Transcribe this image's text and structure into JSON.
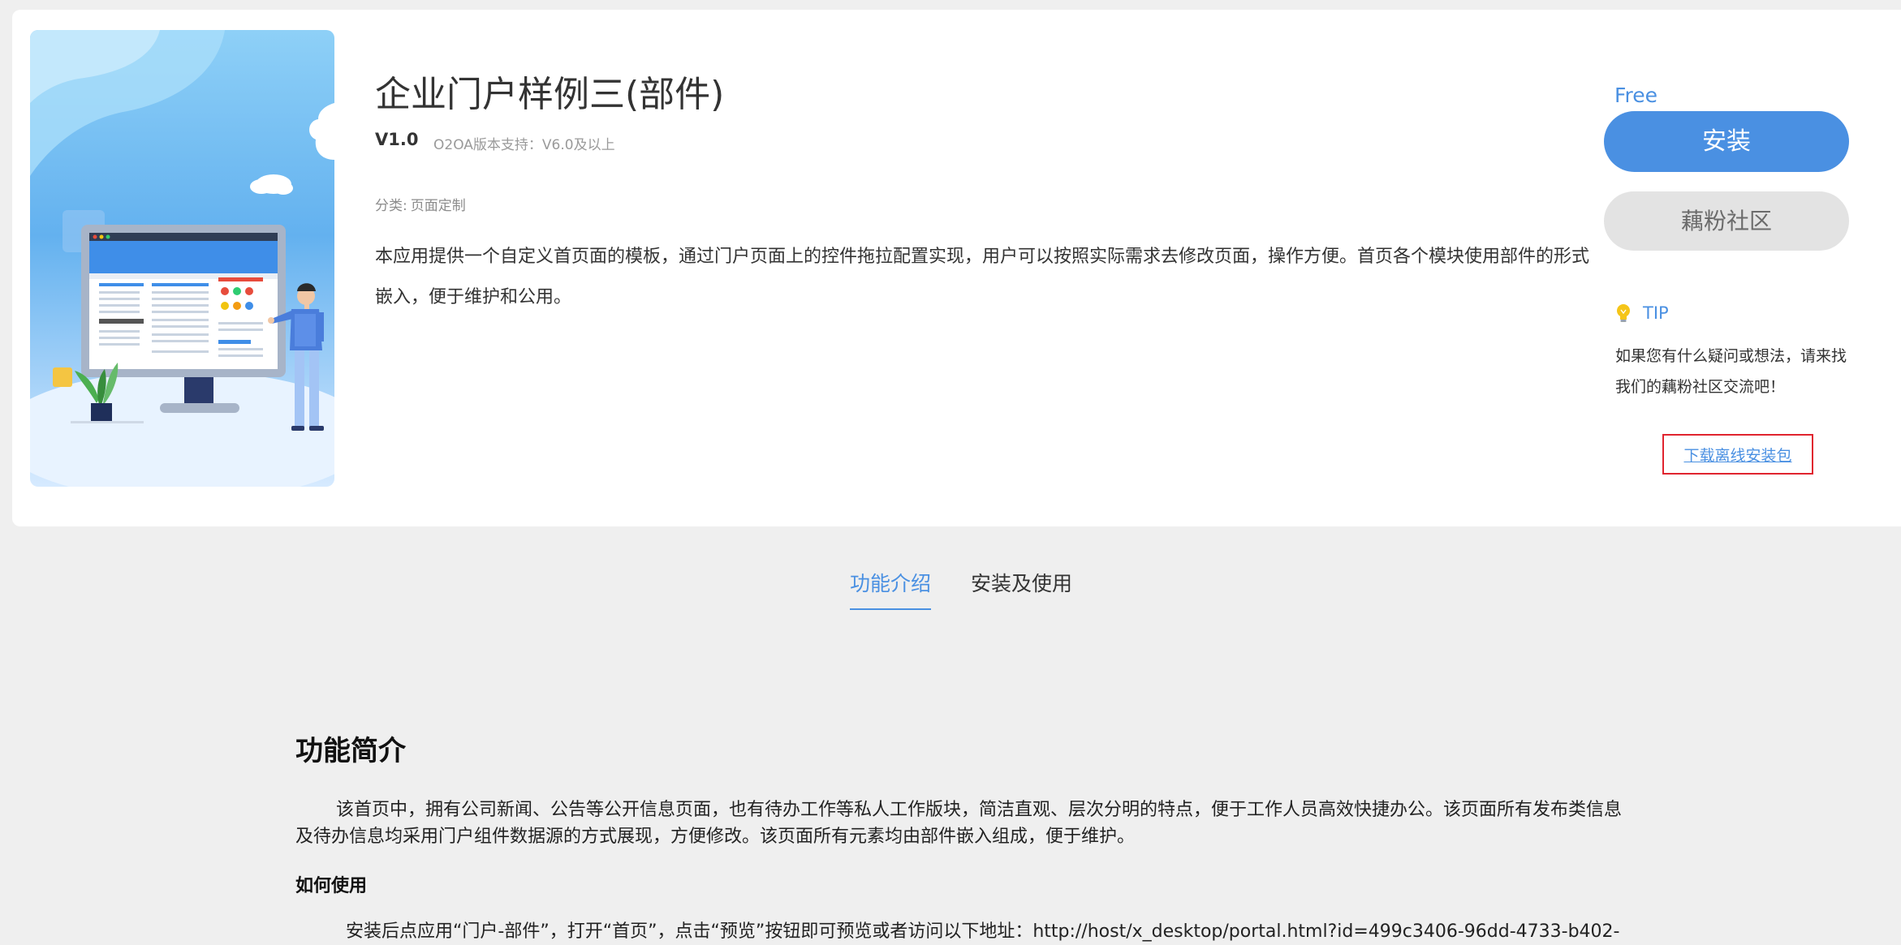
{
  "app": {
    "title": "企业门户样例三(部件)",
    "version": "V1.0",
    "support": "O2OA版本支持：V6.0及以上",
    "category_label": "分类:",
    "category_value": "页面定制",
    "description": "本应用提供一个自定义首页面的模板，通过门户页面上的控件拖拉配置实现，用户可以按照实际需求去修改页面，操作方便。首页各个模块使用部件的形式嵌入，便于维护和公用。"
  },
  "sidebar": {
    "price": "Free",
    "install_label": "安装",
    "community_label": "藕粉社区",
    "tip_label": "TIP",
    "tip_text": "如果您有什么疑问或想法，请来找我们的藕粉社区交流吧！",
    "download_label": "下载离线安装包"
  },
  "tabs": [
    {
      "label": "功能介绍",
      "active": true
    },
    {
      "label": "安装及使用",
      "active": false
    }
  ],
  "content": {
    "intro_heading": "功能简介",
    "intro_text": "该首页中，拥有公司新闻、公告等公开信息页面，也有待办工作等私人工作版块，简洁直观、层次分明的特点，便于工作人员高效快捷办公。该页面所有发布类信息及待办信息均采用门户组件数据源的方式展现，方便修改。该页面所有元素均由部件嵌入组成，便于维护。",
    "usage_heading": "如何使用",
    "usage_text": "安装后点应用“门户-部件”，打开“首页”，点击“预览”按钮即可预览或者访问以下地址：http://host/x_desktop/portal.html?id=499c3406-96dd-4733-b402-"
  },
  "colors": {
    "accent": "#4a90e2",
    "highlight_border": "#e0242f",
    "page_bg": "#efefef"
  },
  "icons": {
    "tip": "lightbulb-icon"
  }
}
